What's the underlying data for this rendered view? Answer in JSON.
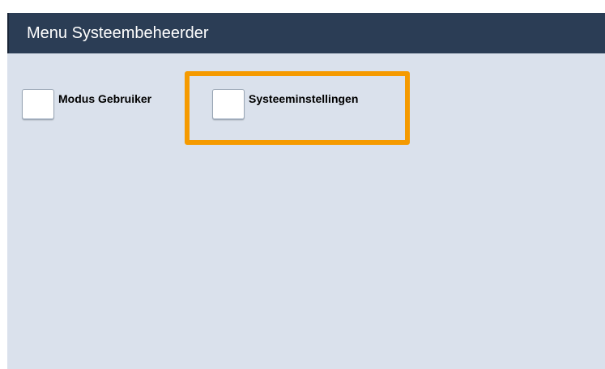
{
  "header": {
    "title": "Menu Systeembeheerder"
  },
  "options": {
    "mode_user_label": "Modus Gebruiker",
    "system_settings_label": "Systeeminstellingen"
  },
  "colors": {
    "header_bg": "#2b3d55",
    "content_bg": "#dae1ec",
    "highlight": "#f59a00"
  }
}
